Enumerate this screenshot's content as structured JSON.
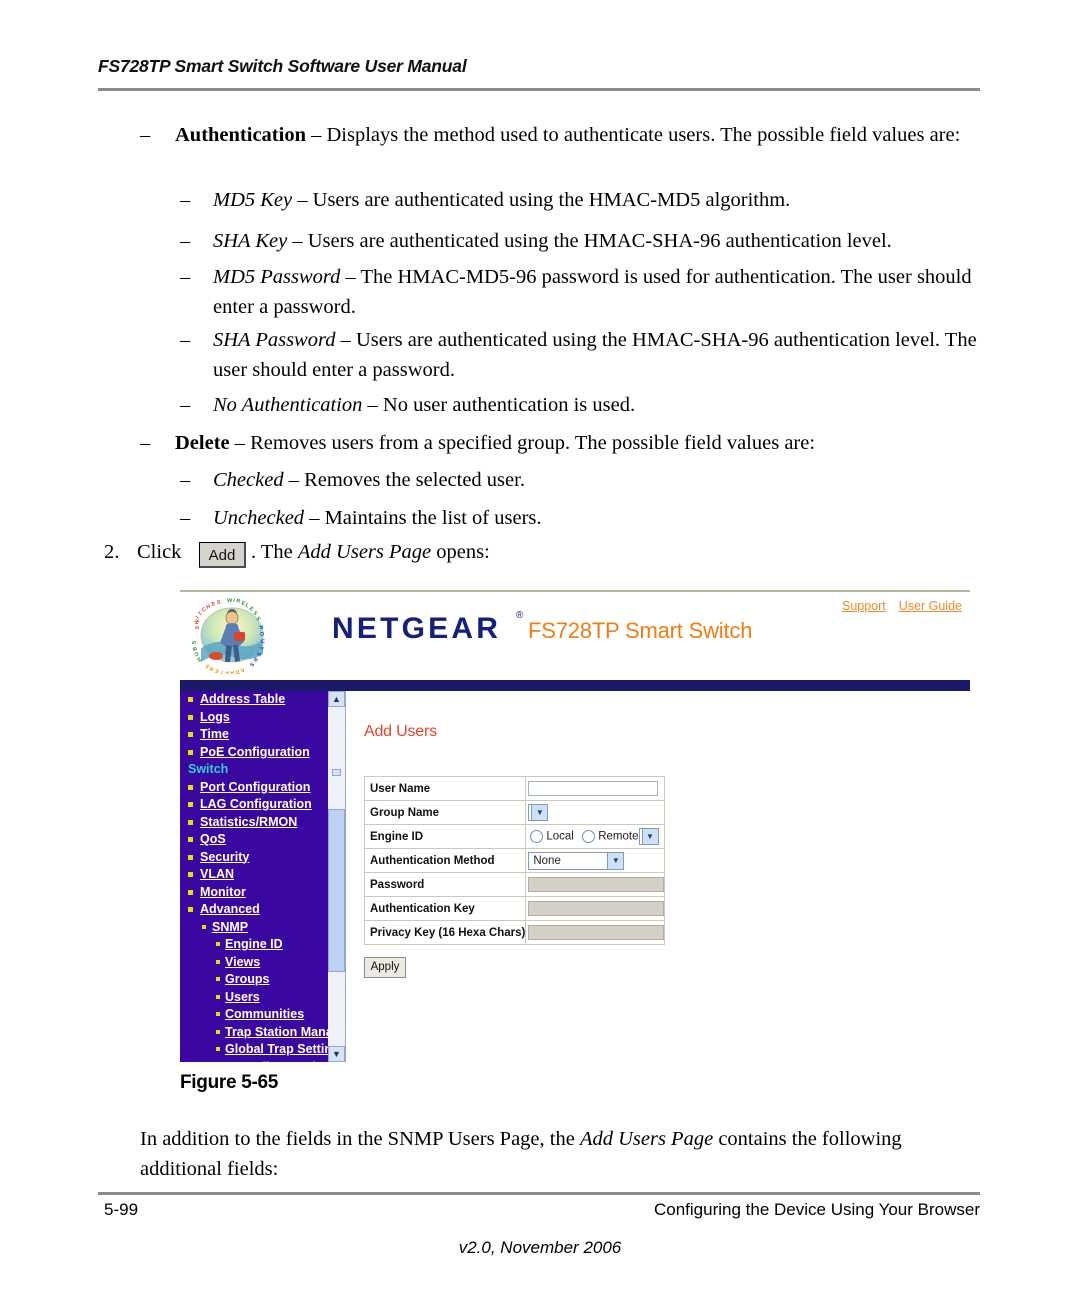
{
  "running_head": "FS728TP Smart Switch Software User Manual",
  "body": {
    "auth_bullet": {
      "dash": "–",
      "term": "Authentication",
      "rest": " – Displays the method used to authenticate users. The possible field values are:"
    },
    "sub_bullets": [
      {
        "dash": "–",
        "term": "MD5 Key",
        "rest": " – Users are authenticated using the HMAC-MD5 algorithm."
      },
      {
        "dash": "–",
        "term": "SHA Key",
        "rest": " – Users are authenticated using the HMAC-SHA-96 authentication level."
      },
      {
        "dash": "–",
        "term": "MD5 Password",
        "rest": " – The HMAC-MD5-96 password is used for authentication. The user should enter a password."
      },
      {
        "dash": "–",
        "term": "SHA Password",
        "rest": " – Users are authenticated using the HMAC-SHA-96 authentication level. The user should enter a password."
      },
      {
        "dash": "–",
        "term": "No Authentication",
        "rest": " – No user authentication is used."
      }
    ],
    "delete_bullet": {
      "dash": "–",
      "term": "Delete",
      "rest": " – Removes users from a specified group. The possible field values are:"
    },
    "delete_sub": [
      {
        "dash": "–",
        "term": "Checked",
        "rest": " – Removes the selected user."
      },
      {
        "dash": "–",
        "term": "Unchecked",
        "rest": " – Maintains the list of users."
      }
    ],
    "step": {
      "number": "2.",
      "before": "Click",
      "button_label": "Add",
      "after_plain": ". The ",
      "after_italic": "Add Users Page",
      "after_tail": " opens:"
    },
    "figure_caption": "Figure 5-65",
    "closing": {
      "part1": "In addition to the fields in the SNMP Users Page, the ",
      "italic": "Add Users Page",
      "part2": " contains the following additional fields:"
    }
  },
  "footer": {
    "page_number": "5-99",
    "section": "Configuring the Device Using Your Browser",
    "version": "v2.0, November 2006"
  },
  "screenshot": {
    "brand": {
      "wordmark": "NETGEAR",
      "registered": "®",
      "model": "FS728TP Smart Switch",
      "links": [
        {
          "label": "Support"
        },
        {
          "label": "User Guide"
        }
      ]
    },
    "sidebar": {
      "items": [
        {
          "label": "Address Table",
          "type": "link",
          "depth": 0
        },
        {
          "label": "Logs",
          "type": "link",
          "depth": 0
        },
        {
          "label": "Time",
          "type": "link",
          "depth": 0
        },
        {
          "label": "PoE Configuration",
          "type": "link",
          "depth": 0
        },
        {
          "label": "Switch",
          "type": "section",
          "depth": 0
        },
        {
          "label": "Port Configuration",
          "type": "link",
          "depth": 0
        },
        {
          "label": "LAG Configuration",
          "type": "link",
          "depth": 0
        },
        {
          "label": "Statistics/RMON",
          "type": "link",
          "depth": 0
        },
        {
          "label": "QoS",
          "type": "link",
          "depth": 0
        },
        {
          "label": "Security",
          "type": "link",
          "depth": 0
        },
        {
          "label": "VLAN",
          "type": "link",
          "depth": 0
        },
        {
          "label": "Monitor",
          "type": "link",
          "depth": 0
        },
        {
          "label": "Advanced",
          "type": "link",
          "depth": 0
        },
        {
          "label": "SNMP",
          "type": "link",
          "depth": 1
        },
        {
          "label": "Engine ID",
          "type": "link",
          "depth": 2
        },
        {
          "label": "Views",
          "type": "link",
          "depth": 2
        },
        {
          "label": "Groups",
          "type": "link",
          "depth": 2
        },
        {
          "label": "Users",
          "type": "link",
          "depth": 2
        },
        {
          "label": "Communities",
          "type": "link",
          "depth": 2
        },
        {
          "label": "Trap Station Manage",
          "type": "link",
          "depth": 2
        },
        {
          "label": "Global Trap Settings",
          "type": "link",
          "depth": 2
        },
        {
          "label": "Trap Filter Settings",
          "type": "link",
          "depth": 2
        }
      ],
      "scroll_up_glyph": "▲",
      "scroll_down_glyph": "▼"
    },
    "content": {
      "title": "Add Users",
      "fields": [
        {
          "label": "User Name",
          "control": "text",
          "value": ""
        },
        {
          "label": "Group Name",
          "control": "select-small",
          "value": ""
        },
        {
          "label": "Engine ID",
          "control": "radio-select",
          "radios": [
            "Local",
            "Remote"
          ],
          "value": ""
        },
        {
          "label": "Authentication Method",
          "control": "select-wide",
          "value": "None"
        },
        {
          "label": "Password",
          "control": "text-disabled",
          "value": ""
        },
        {
          "label": "Authentication Key",
          "control": "text-disabled",
          "value": ""
        },
        {
          "label": "Privacy Key (16 Hexa Chars)",
          "control": "text-disabled",
          "value": ""
        }
      ],
      "apply_label": "Apply",
      "select_arrow_glyph": "▼"
    },
    "colors": {
      "sidebar_bg": "#3a07a0",
      "navy_band": "#1a1a66",
      "brand_blue": "#14207a",
      "brand_orange": "#f07d15",
      "title_red": "#e8422e",
      "section_cyan": "#2fd0d8",
      "bullet_yellow": "#e8e000"
    }
  }
}
